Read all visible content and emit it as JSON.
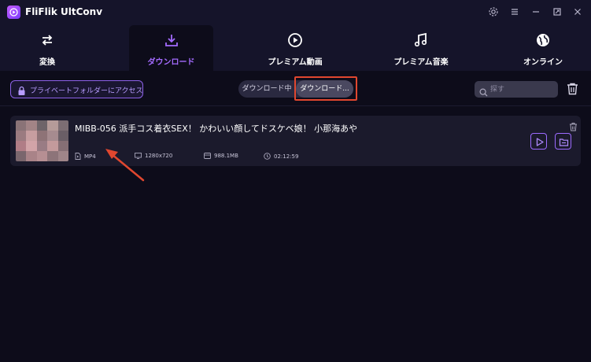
{
  "app": {
    "title": "FliFlik UltConv"
  },
  "window_controls": [
    "settings-icon",
    "menu-icon",
    "minimize-icon",
    "maximize-icon",
    "close-icon"
  ],
  "nav": {
    "tabs": [
      {
        "label": "変換",
        "icon": "convert-icon",
        "active": false
      },
      {
        "label": "ダウンロード",
        "icon": "download-icon",
        "active": true
      },
      {
        "label": "プレミアム動画",
        "icon": "play-circle-icon",
        "active": false
      },
      {
        "label": "プレミアム音楽",
        "icon": "music-note-icon",
        "active": false
      },
      {
        "label": "オンライン",
        "icon": "globe-icon",
        "active": false
      }
    ]
  },
  "toolbar": {
    "private_folder_label": "プライベートフォルダーにアクセス",
    "seg_downloading": "ダウンロード中",
    "seg_downloaded": "ダウンロード...",
    "search_placeholder": "探す"
  },
  "item": {
    "title": "MIBB-056 派手コス着衣SEX！ かわいい顔してドスケベ娘！ 小那海あや",
    "format": "MP4",
    "resolution": "1280x720",
    "size": "988.1MB",
    "duration": "02:12:59"
  },
  "colors": {
    "accent": "#a46bff",
    "highlight": "#e0472f",
    "background": "#0d0c1a",
    "panel": "#15142a"
  }
}
